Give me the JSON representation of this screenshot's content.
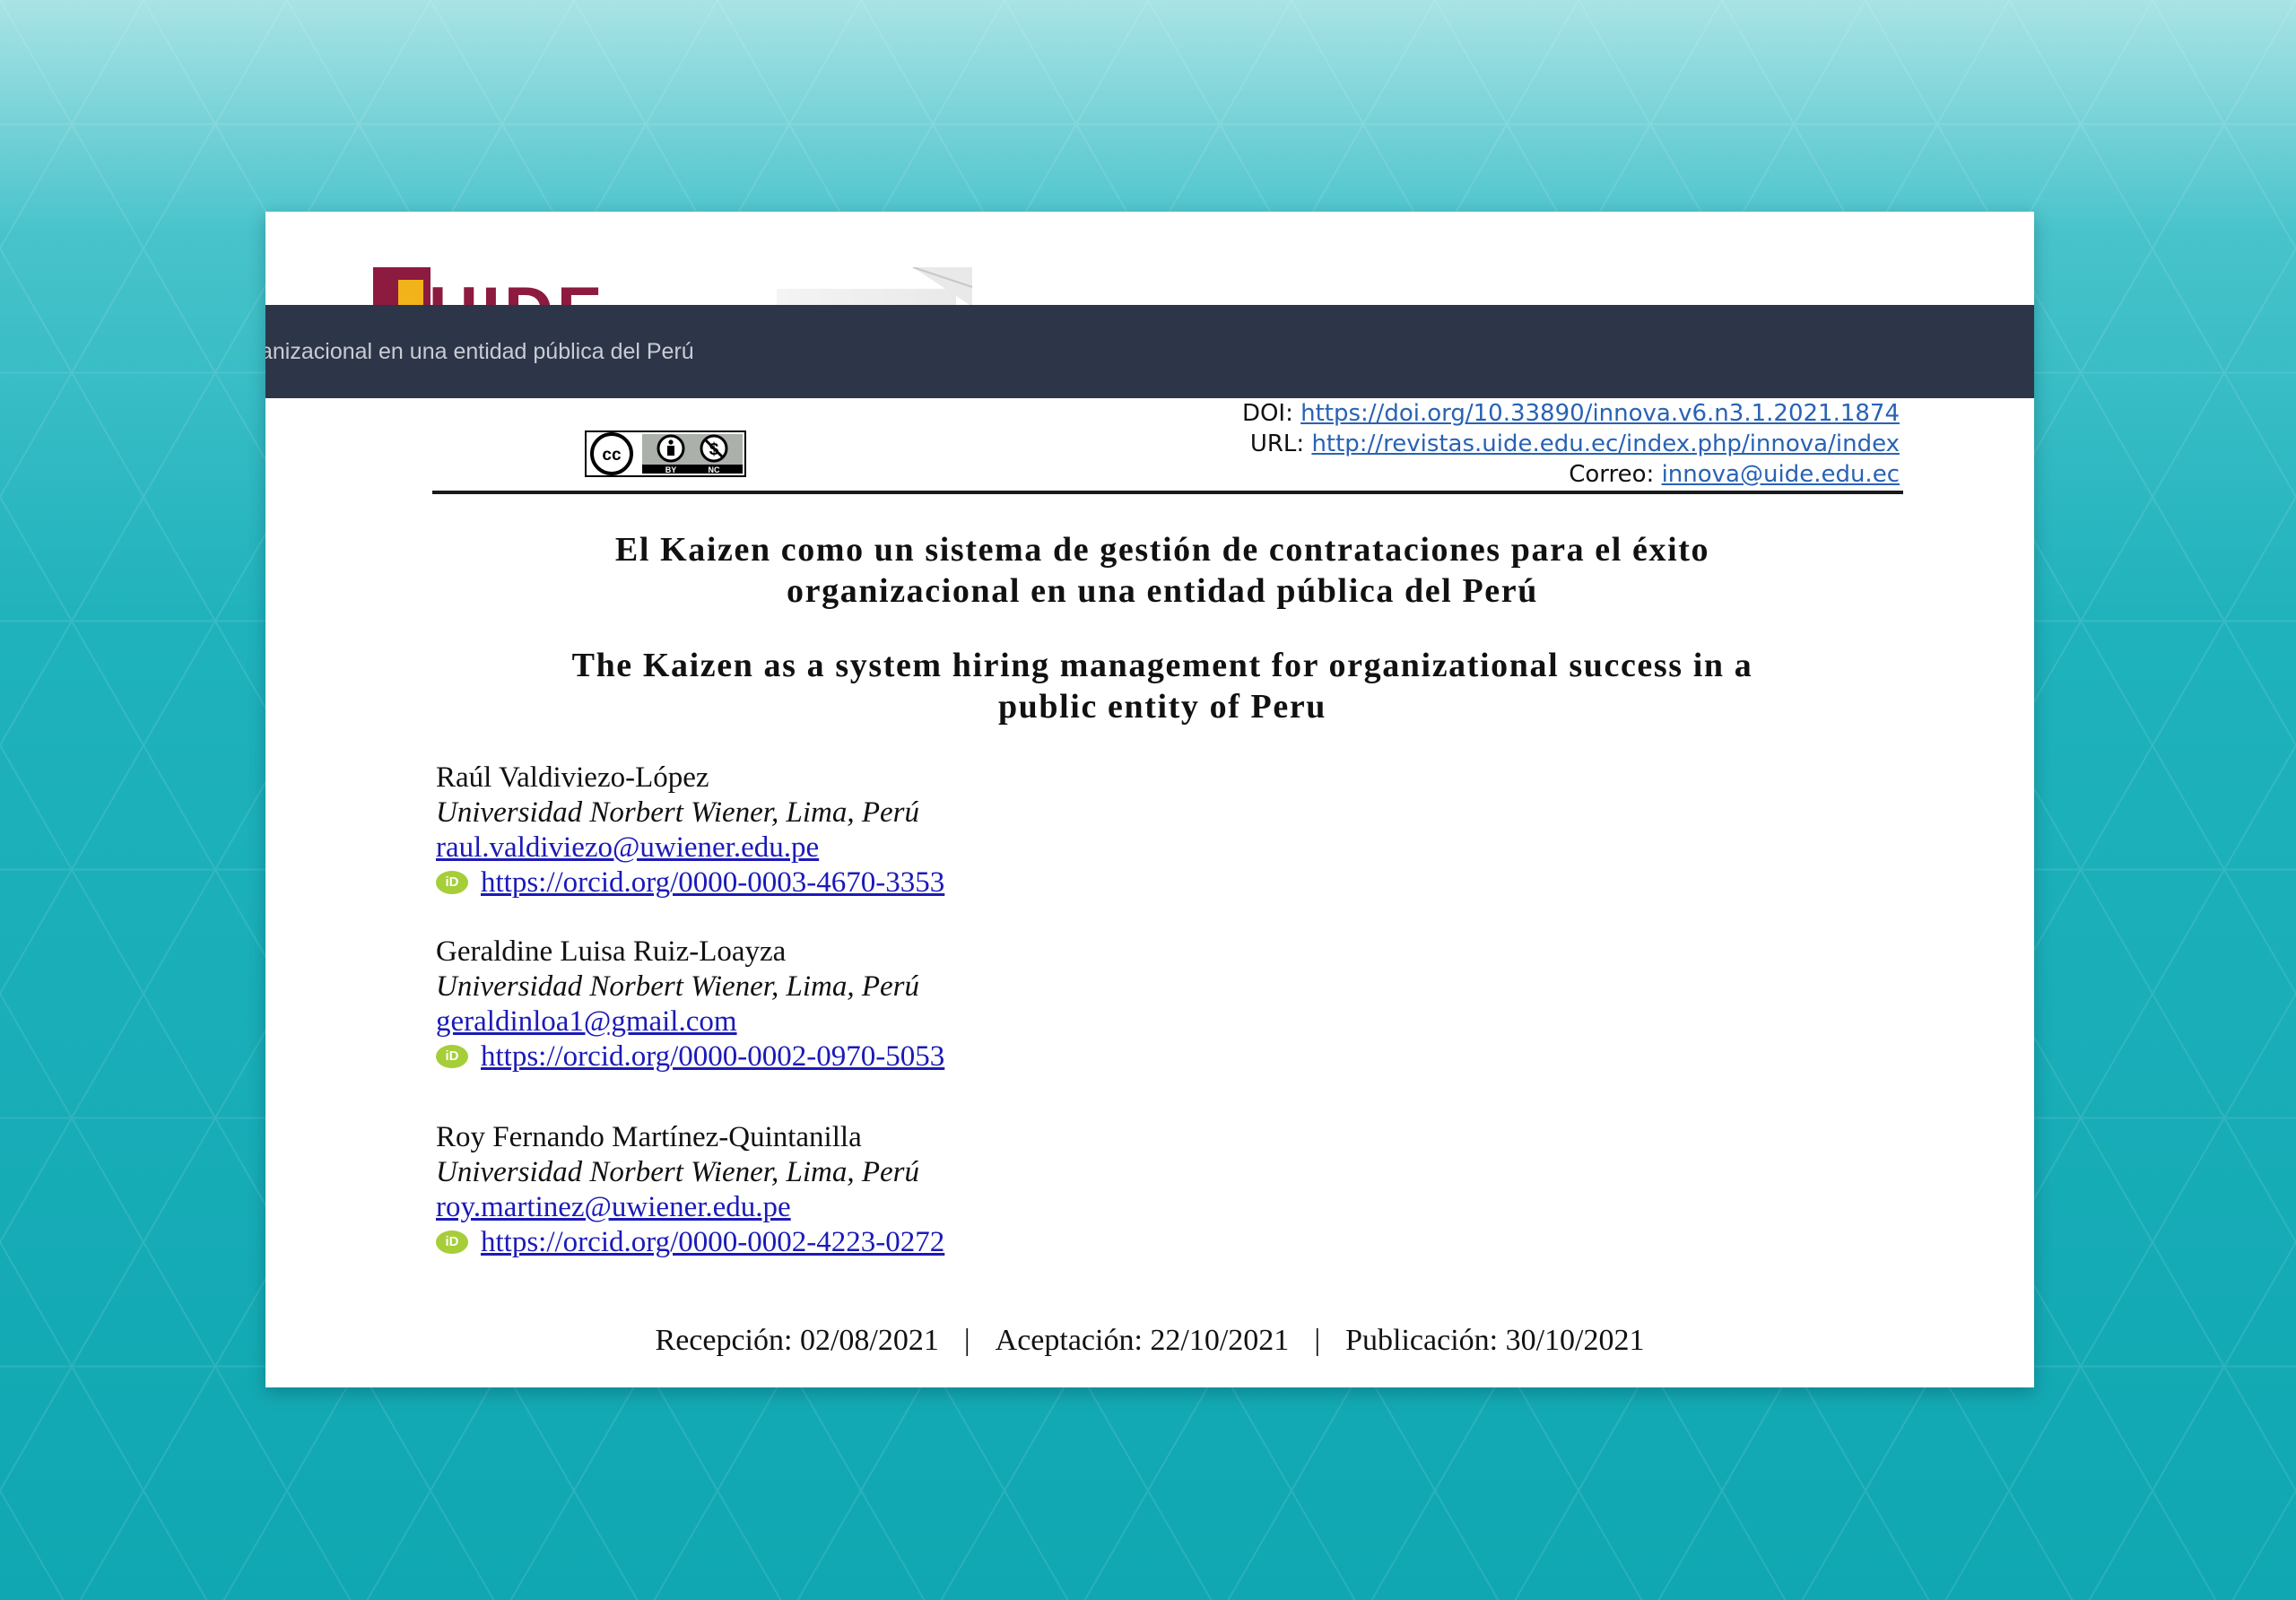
{
  "header": {
    "logo_text": "UIDE",
    "banner_text": "anizacional en una entidad pública del Perú"
  },
  "license": {
    "badge": "CC BY NC",
    "labels": [
      "BY",
      "NC"
    ],
    "icon": "creative-commons-icon"
  },
  "meta": {
    "doi_label": "DOI:",
    "doi_url": "https://doi.org/10.33890/innova.v6.n3.1.2021.1874",
    "url_label": "URL:",
    "url": "http://revistas.uide.edu.ec/index.php/innova/index",
    "email_label": "Correo:",
    "email": "innova@uide.edu.ec"
  },
  "titles": {
    "es_line1": "El Kaizen como un sistema de gestión de contrataciones para el éxito",
    "es_line2": "organizacional en una entidad pública del Perú",
    "en_line1": "The Kaizen as a system hiring management for organizational success in a",
    "en_line2": "public entity of Peru"
  },
  "authors": [
    {
      "name": "Raúl Valdiviezo-López",
      "affiliation": "Universidad Norbert Wiener, Lima, Perú",
      "email": "raul.valdiviezo@uwiener.edu.pe",
      "orcid": "https://orcid.org/0000-0003-4670-3353"
    },
    {
      "name": "Geraldine Luisa Ruiz-Loayza",
      "affiliation": "Universidad Norbert Wiener, Lima, Perú",
      "email": "geraldinloa1@gmail.com",
      "orcid": "https://orcid.org/0000-0002-0970-5053"
    },
    {
      "name": "Roy Fernando Martínez-Quintanilla",
      "affiliation": "Universidad Norbert Wiener, Lima, Perú",
      "email": "roy.martinez@uwiener.edu.pe",
      "orcid": "https://orcid.org/0000-0002-4223-0272"
    }
  ],
  "orcid_icon_label": "iD",
  "dates": {
    "received": "Recepción: 02/08/2021",
    "accepted": "Aceptación: 22/10/2021",
    "published": "Publicación: 30/10/2021",
    "separator": "|"
  },
  "colors": {
    "background_teal": "#1fb2bc",
    "banner": "#2d3548",
    "link": "#1b1ab8",
    "meta_link": "#2862b5",
    "orcid_green": "#a6ce39",
    "logo_red": "#8d1a3f",
    "logo_yellow": "#f2b31a"
  }
}
